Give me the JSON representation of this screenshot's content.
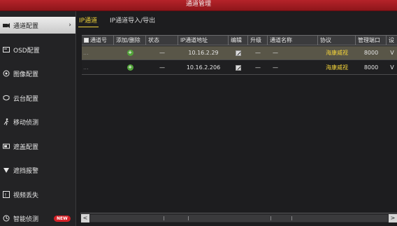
{
  "window": {
    "title": "通道管理"
  },
  "sidebar": {
    "items": [
      {
        "label": "通道配置",
        "icon": "camera-icon",
        "active": true
      },
      {
        "label": "OSD配置",
        "icon": "osd-icon"
      },
      {
        "label": "图像配置",
        "icon": "image-icon"
      },
      {
        "label": "云台配置",
        "icon": "ptz-icon"
      },
      {
        "label": "移动侦测",
        "icon": "motion-icon"
      },
      {
        "label": "遮盖配置",
        "icon": "mask-icon"
      },
      {
        "label": "遮挡报警",
        "icon": "tamper-icon"
      },
      {
        "label": "视频丢失",
        "icon": "video-loss-icon"
      },
      {
        "label": "智能侦测",
        "icon": "smart-icon",
        "badge": "NEW"
      }
    ]
  },
  "tabs": [
    {
      "label": "IP通道",
      "active": true
    },
    {
      "label": "IP通道导入/导出"
    }
  ],
  "table": {
    "headers": [
      "通道号",
      "添加/删除",
      "状态",
      "IP通道地址",
      "编辑",
      "升级",
      "通道名称",
      "协议",
      "管理端口",
      "设"
    ],
    "rows": [
      {
        "channel": "...",
        "status": "—",
        "ip": "10.16.2.29",
        "upgrade": "—",
        "name": "—",
        "protocol": "海康威视",
        "port": "8000",
        "extra": "V"
      },
      {
        "channel": "...",
        "status": "—",
        "ip": "10.16.2.206",
        "upgrade": "—",
        "name": "—",
        "protocol": "海康威视",
        "port": "8000",
        "extra": "V"
      }
    ]
  },
  "scrollbar": {
    "left_arrow": "<",
    "right_arrow": ">"
  },
  "colors": {
    "titlebar": "#a81d23",
    "accent": "#f0d23a",
    "selected_row": "#595648",
    "add_green": "#53a33a"
  }
}
